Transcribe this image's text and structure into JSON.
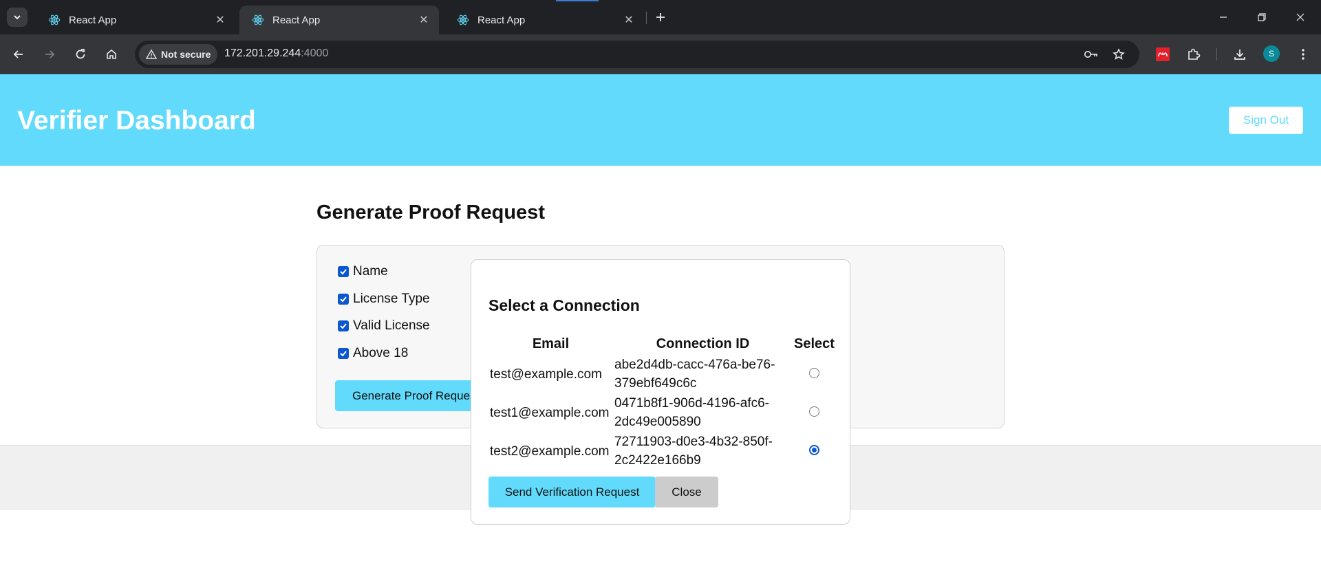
{
  "browser": {
    "tabs": [
      {
        "title": "React App",
        "active": false
      },
      {
        "title": "React App",
        "active": true
      },
      {
        "title": "React App",
        "active": false
      }
    ],
    "security_label": "Not secure",
    "url_host": "172.201.29.244",
    "url_port": ":4000",
    "profile_initial": "S",
    "icons": {
      "tab_search": "chevron-down-icon",
      "favicon": "react-logo-icon",
      "tab_close": "close-icon",
      "new_tab": "plus-icon",
      "minimize": "minimize-icon",
      "restore": "restore-icon",
      "close_window": "close-icon",
      "back": "arrow-left-icon",
      "forward": "arrow-right-icon",
      "reload": "reload-icon",
      "home": "home-icon",
      "warning": "warning-icon",
      "password": "key-icon",
      "bookmark": "star-icon",
      "extension_red": "mendeley-extension-icon",
      "extensions": "puzzle-icon",
      "downloads": "download-icon",
      "menu": "kebab-menu-icon"
    }
  },
  "header": {
    "title": "Verifier Dashboard",
    "sign_out": "Sign Out"
  },
  "proof": {
    "section_title": "Generate Proof Request",
    "attributes": [
      {
        "label": "Name",
        "checked": true
      },
      {
        "label": "License Type",
        "checked": true
      },
      {
        "label": "Valid License",
        "checked": true
      },
      {
        "label": "Above 18",
        "checked": true
      }
    ],
    "generate_button": "Generate Proof Request"
  },
  "modal": {
    "title": "Select a Connection",
    "columns": [
      "Email",
      "Connection ID",
      "Select"
    ],
    "rows": [
      {
        "email": "test@example.com",
        "connection_id": "abe2d4db-cacc-476a-be76-379ebf649c6c",
        "selected": false
      },
      {
        "email": "test1@example.com",
        "connection_id": "0471b8f1-906d-4196-afc6-2dc49e005890",
        "selected": false
      },
      {
        "email": "test2@example.com",
        "connection_id": "72711903-d0e3-4b32-850f-2c2422e166b9",
        "selected": true
      }
    ],
    "send_button": "Send Verification Request",
    "close_button": "Close"
  },
  "colors": {
    "accent": "#61dafb",
    "chrome_dark": "#202124",
    "chrome_toolbar": "#35363a",
    "checkbox_blue": "#0b57d0"
  }
}
